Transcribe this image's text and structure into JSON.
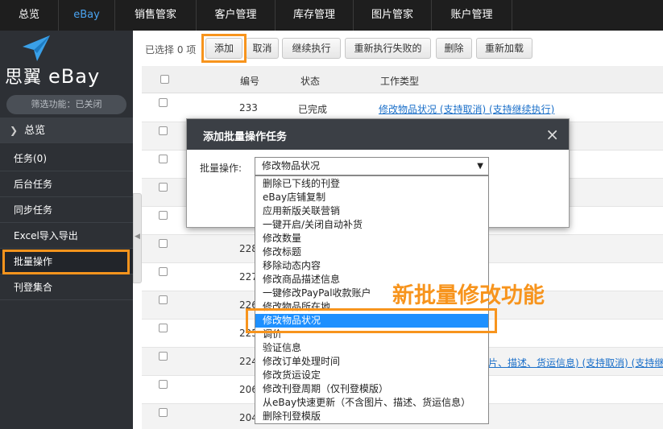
{
  "topnav": {
    "items": [
      {
        "label": "总览",
        "w": 73,
        "active": false
      },
      {
        "label": "eBay",
        "w": 70,
        "active": true
      },
      {
        "label": "销售管家",
        "w": 101,
        "active": false
      },
      {
        "label": "客户管理",
        "w": 98,
        "active": false
      },
      {
        "label": "库存管理",
        "w": 97,
        "active": false
      },
      {
        "label": "图片管家",
        "w": 97,
        "active": false
      },
      {
        "label": "账户管理",
        "w": 100,
        "active": false
      }
    ]
  },
  "sidebar": {
    "brand_cn": "思翼",
    "brand_en": "eBay",
    "filter": "筛选功能：已关闭",
    "items": [
      {
        "label": "总览"
      },
      {
        "label": "任务(0)"
      },
      {
        "label": "后台任务"
      },
      {
        "label": "同步任务"
      },
      {
        "label": "Excel导入导出"
      },
      {
        "label": "批量操作"
      },
      {
        "label": "刊登集合"
      }
    ]
  },
  "toolbar": {
    "selected_count": "已选择 0 项",
    "buttons": [
      "添加",
      "取消",
      "继续执行",
      "重新执行失败的",
      "删除",
      "重新加载"
    ]
  },
  "table": {
    "headers": [
      "编号",
      "状态",
      "工作类型"
    ],
    "rows": [
      {
        "id": "233",
        "status": "已完成",
        "type": "修改物品状况 (支持取消) (支持继续执行)"
      },
      {
        "id": "",
        "status": "",
        "type": ""
      },
      {
        "id": "",
        "status": "",
        "type": ""
      },
      {
        "id": "",
        "status": "",
        "type": ""
      },
      {
        "id": "",
        "status": "",
        "type": ""
      },
      {
        "id": "228",
        "status": "",
        "type": ""
      },
      {
        "id": "227",
        "status": "",
        "type": ""
      },
      {
        "id": "226",
        "status": "",
        "type": ""
      },
      {
        "id": "225",
        "status": "",
        "type": ""
      },
      {
        "id": "224",
        "status": "",
        "type": "片、描述、货运信息) (支持取消) (支持继"
      },
      {
        "id": "206",
        "status": "",
        "type": ""
      },
      {
        "id": "204",
        "status": "",
        "type": ""
      }
    ]
  },
  "modal": {
    "title": "添加批量操作任务",
    "close": "×",
    "field_label": "批量操作:",
    "selected_value": "修改物品状况",
    "options": [
      "删除已下线的刊登",
      "eBay店铺复制",
      "应用新版关联营销",
      "一键开启/关闭自动补货",
      "修改数量",
      "修改标题",
      "移除动态内容",
      "修改商品描述信息",
      "一键修改PayPal收款账户",
      "修改物品所在地",
      "修改物品状况",
      "调价",
      "验证信息",
      "修改订单处理时间",
      "修改货运设定",
      "修改刊登周期（仅刊登模版）",
      "从eBay快速更新（不含图片、描述、货运信息）",
      "删除刊登模版"
    ]
  },
  "callout": "新批量修改功能",
  "colors": {
    "accent": "#f7941d",
    "link": "#1a6fc9",
    "selected": "#1e90ff"
  }
}
